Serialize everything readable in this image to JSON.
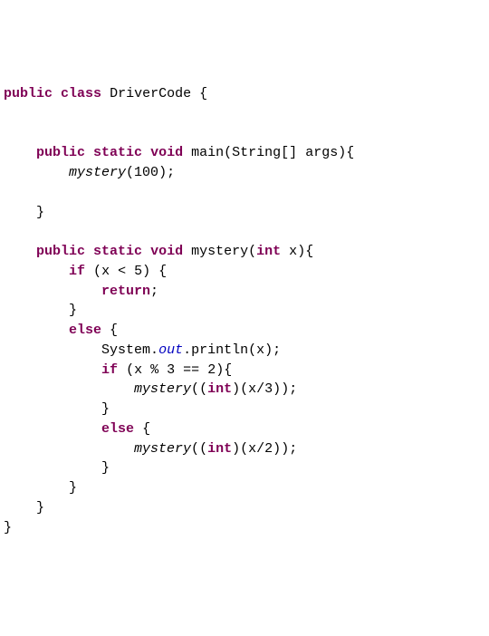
{
  "kw": {
    "public": "public",
    "class": "class",
    "static": "static",
    "void": "void",
    "if": "if",
    "else": "else",
    "return": "return",
    "int": "int"
  },
  "names": {
    "DriverCode": "DriverCode",
    "main": "main",
    "String": "String",
    "args": "args",
    "mystery": "mystery",
    "x": "x",
    "System": "System",
    "out": "out",
    "println": "println"
  },
  "nums": {
    "n100": "100",
    "n5": "5",
    "n3a": "3",
    "n2a": "2",
    "n3b": "3",
    "n2b": "2"
  }
}
